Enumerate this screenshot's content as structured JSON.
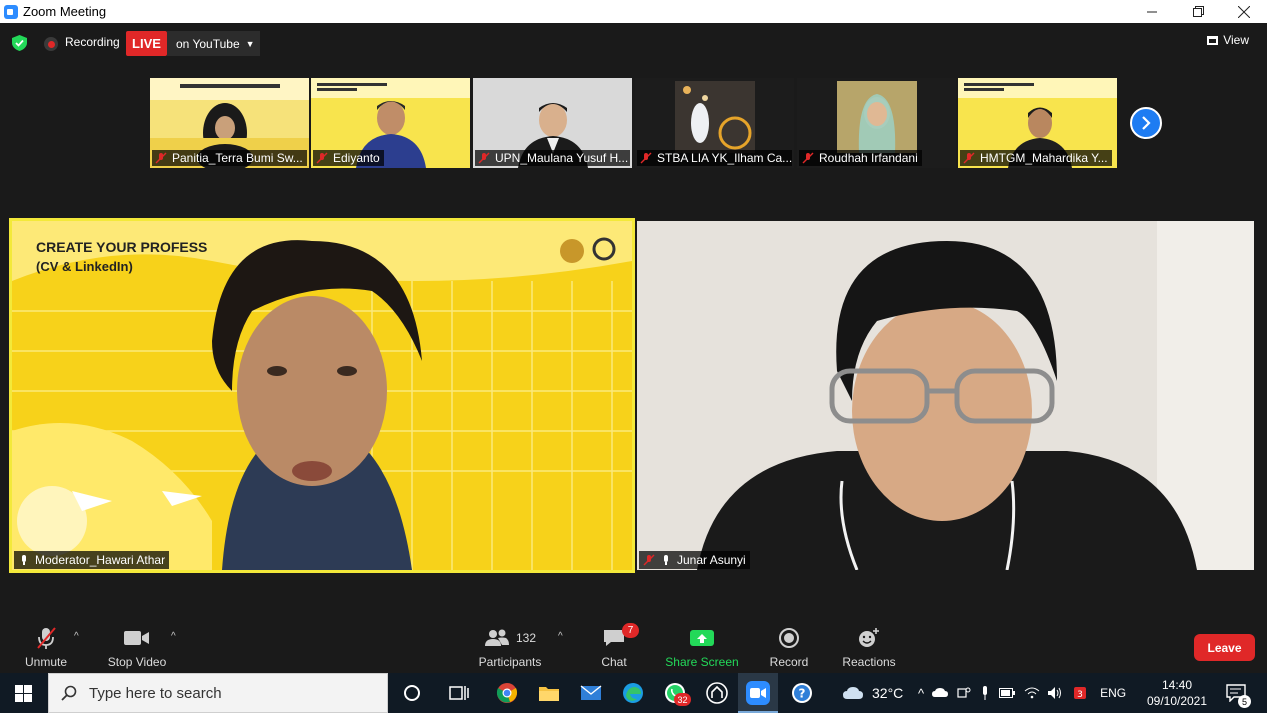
{
  "window": {
    "title": "Zoom Meeting",
    "minimize_icon": "minimize-icon",
    "restore_icon": "restore-icon",
    "close_icon": "close-icon"
  },
  "topbar": {
    "recording_label": "Recording",
    "live_label": "LIVE",
    "stream_target": "on YouTube",
    "view_label": "View"
  },
  "thumbnails": [
    {
      "name": "Panitia_Terra Bumi Sw..."
    },
    {
      "name": "Ediyanto"
    },
    {
      "name": "UPN_Maulana Yusuf H..."
    },
    {
      "name": "STBA LIA YK_Ilham Ca..."
    },
    {
      "name": "Roudhah Irfandani"
    },
    {
      "name": "HMTGM_Mahardika Y..."
    }
  ],
  "slide_text": {
    "heading": "CREATE YOUR PROFESS",
    "sub": "(CV & LinkedIn)"
  },
  "main_tiles": [
    {
      "name": "Moderator_Hawari Athar",
      "active_speaker": true
    },
    {
      "name": "Junar Asunyi",
      "active_speaker": false
    }
  ],
  "controls": {
    "unmute": "Unmute",
    "stop_video": "Stop Video",
    "participants": "Participants",
    "participants_count": "132",
    "chat": "Chat",
    "chat_badge": "7",
    "share_screen": "Share Screen",
    "record": "Record",
    "reactions": "Reactions",
    "leave": "Leave"
  },
  "taskbar": {
    "search_placeholder": "Type here to search",
    "whatsapp_badge": "32",
    "weather": "32°C",
    "language": "ENG",
    "time": "14:40",
    "date": "09/10/2021",
    "notification_count": "5"
  },
  "colors": {
    "accent_blue": "#2d8cff",
    "live_red": "#e02828",
    "share_green": "#23d959",
    "speaker_yellow": "#f3e93a",
    "slide_yellow": "#f7d21a"
  }
}
